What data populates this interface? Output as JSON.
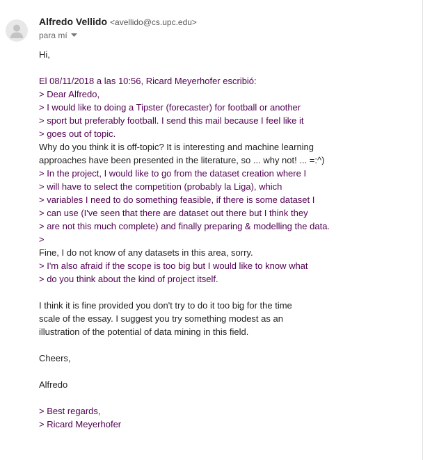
{
  "header": {
    "sender_name": "Alfredo Vellido",
    "sender_email": "<avellido@cs.upc.edu>",
    "recipient": "para mí",
    "avatar_icon": "person-icon",
    "caret_icon": "caret-down-icon"
  },
  "colors": {
    "quoted_text": "#500050",
    "body_text": "#222222"
  },
  "message": {
    "lines": [
      {
        "type": "text",
        "text": "Hi,"
      },
      {
        "type": "blank",
        "text": ""
      },
      {
        "type": "quote",
        "text": "El 08/11/2018 a las 10:56, Ricard Meyerhofer escribió:"
      },
      {
        "type": "quote",
        "text": "> Dear Alfredo,"
      },
      {
        "type": "quote",
        "text": "> I would like to doing a Tipster (forecaster) for football or another"
      },
      {
        "type": "quote",
        "text": "> sport but preferably football. I send this mail because I feel like it"
      },
      {
        "type": "quote",
        "text": "> goes out of topic."
      },
      {
        "type": "text",
        "text": "Why do you think it is off-topic? It is interesting and machine learning"
      },
      {
        "type": "text",
        "text": "approaches have been presented in the literature, so ... why not! ... =:^)"
      },
      {
        "type": "quote",
        "text": "> In the project, I would like to go from the dataset creation where I"
      },
      {
        "type": "quote",
        "text": "> will have to select the competition (probably la Liga), which"
      },
      {
        "type": "quote",
        "text": "> variables I need to do something feasible, if there is some dataset I"
      },
      {
        "type": "quote",
        "text": "> can use (I've seen that there are dataset out there but I think they"
      },
      {
        "type": "quote",
        "text": "> are not this much complete) and finally preparing & modelling the data."
      },
      {
        "type": "quote",
        "text": ">"
      },
      {
        "type": "text",
        "text": "Fine, I do not know of any datasets in this area, sorry."
      },
      {
        "type": "quote",
        "text": "> I'm also afraid if the scope is too big but I would like to know what"
      },
      {
        "type": "quote",
        "text": "> do you think about the kind of project itself."
      },
      {
        "type": "blank",
        "text": ""
      },
      {
        "type": "text",
        "text": "I think it is fine provided you don't try to do it too big for the time"
      },
      {
        "type": "text",
        "text": "scale of the essay. I suggest you try something modest as an"
      },
      {
        "type": "text",
        "text": "illustration of the potential of data mining in this field."
      },
      {
        "type": "blank",
        "text": ""
      },
      {
        "type": "text",
        "text": "Cheers,"
      },
      {
        "type": "blank",
        "text": ""
      },
      {
        "type": "text",
        "text": "Alfredo"
      },
      {
        "type": "blank",
        "text": ""
      },
      {
        "type": "quote",
        "text": "> Best regards,"
      },
      {
        "type": "quote",
        "text": "> Ricard Meyerhofer"
      }
    ]
  }
}
